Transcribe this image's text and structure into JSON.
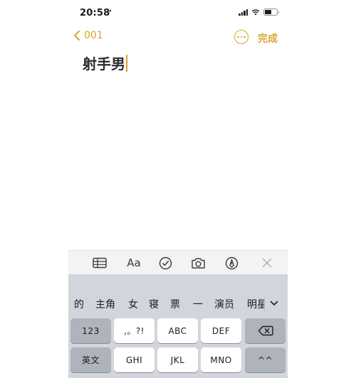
{
  "status_bar": {
    "time": "20:58",
    "location_arrow": "➚",
    "icons": [
      "signal-icon",
      "wifi-icon",
      "battery-icon"
    ]
  },
  "nav": {
    "back_label": "001",
    "more_icon": "ellipsis-circle-icon",
    "done_label": "完成"
  },
  "note": {
    "title": "射手男"
  },
  "toolbar": {
    "aa_label": "Aa",
    "items": [
      "table-icon",
      "text-format-icon",
      "checklist-icon",
      "camera-icon",
      "markup-pen-icon",
      "close-icon"
    ]
  },
  "keyboard": {
    "candidates": [
      "的",
      "主角",
      "女",
      "寝",
      "票",
      "一",
      "演员",
      "明星"
    ],
    "row1": [
      "123",
      ",。?!",
      "ABC",
      "DEF"
    ],
    "row2": [
      "英文",
      "GHI",
      "JKL",
      "MNO",
      "^^"
    ],
    "delete_icon": "delete-backspace-icon",
    "expand_icon": "chevron-down-icon"
  },
  "colors": {
    "accent": "#d4a82a",
    "keyboard_bg": "#d2d5db",
    "key_dark": "#aeb3bc"
  }
}
